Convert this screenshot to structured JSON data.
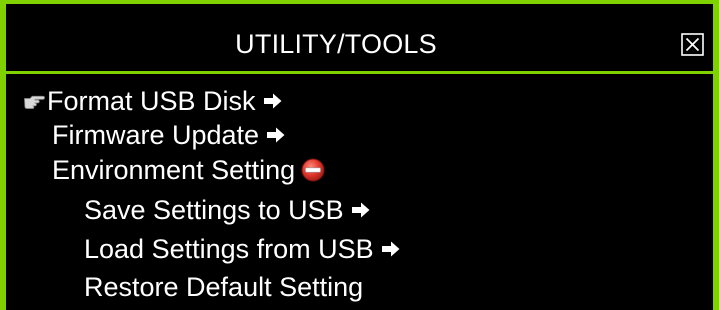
{
  "colors": {
    "background": "#000000",
    "border": "#7fd100",
    "text": "#ffffff",
    "collapse_icon": "#e0352b"
  },
  "header": {
    "title": "UTILITY/TOOLS",
    "close_icon": "close-box-icon"
  },
  "menu": {
    "pointer_icon": "pointing-hand-icon",
    "items": [
      {
        "label": "Format USB Disk",
        "selected": true,
        "icon": "right-arrow-icon"
      },
      {
        "label": "Firmware Update",
        "icon": "right-arrow-icon"
      },
      {
        "label": "Environment Setting",
        "icon": "collapse-minus-icon",
        "expanded": true,
        "children": [
          {
            "label": "Save Settings to USB",
            "icon": "right-arrow-icon"
          },
          {
            "label": "Load Settings from USB",
            "icon": "right-arrow-icon"
          },
          {
            "label": "Restore Default Setting"
          }
        ]
      }
    ]
  }
}
